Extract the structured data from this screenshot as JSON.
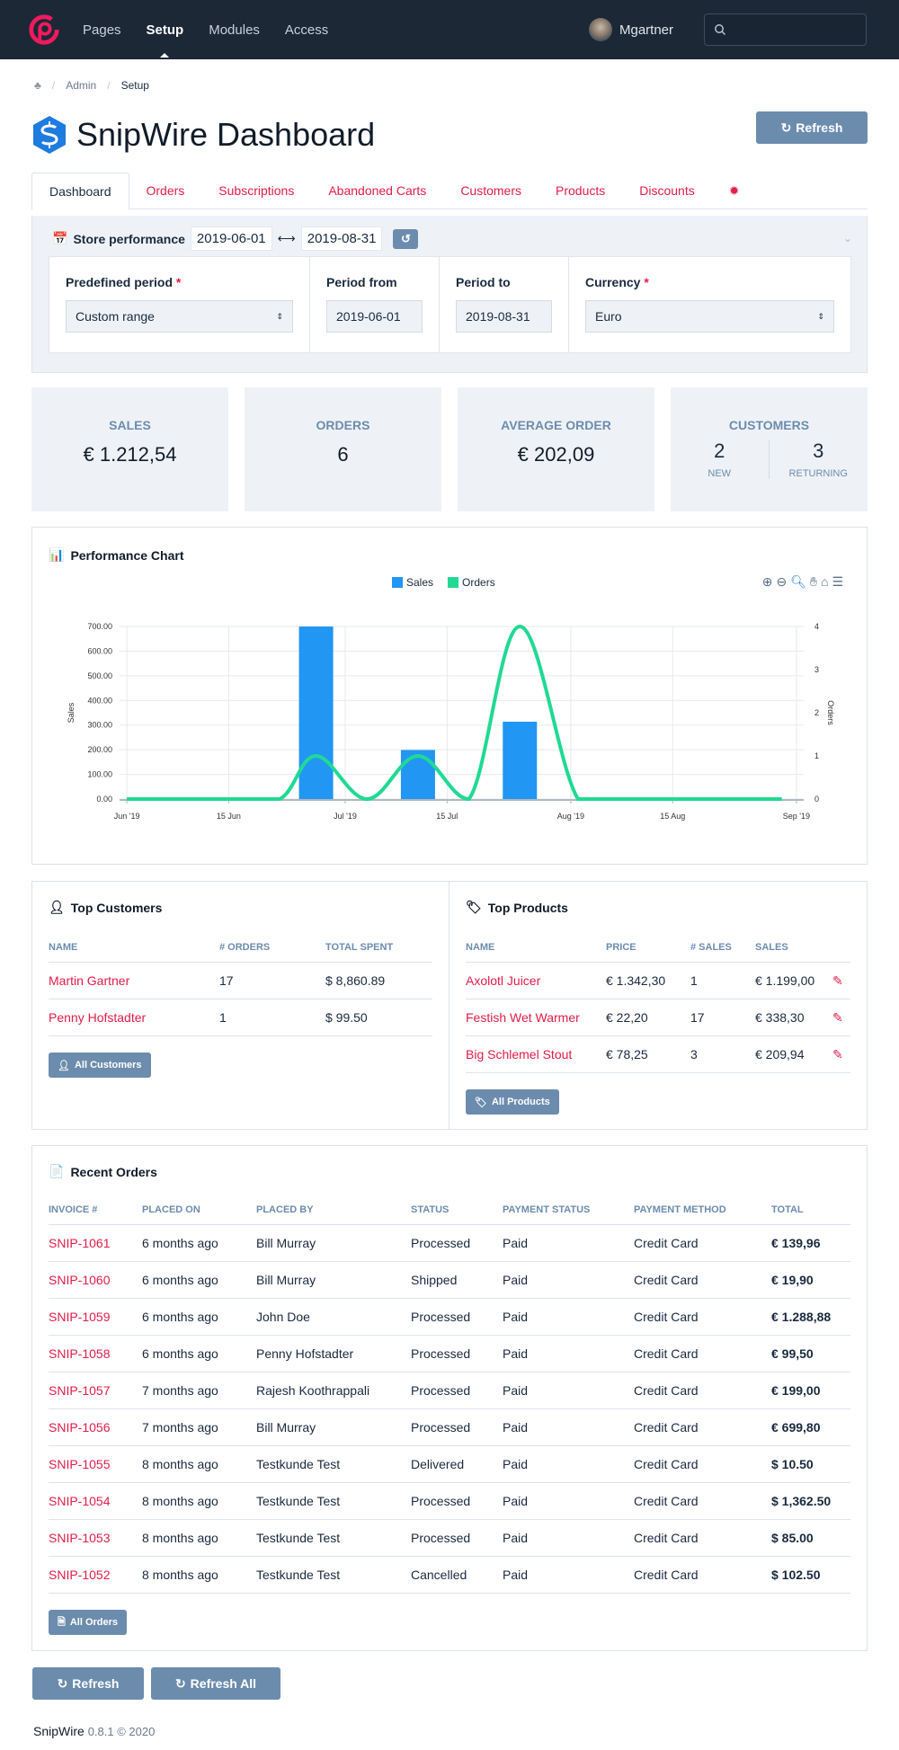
{
  "topbar": {
    "nav": [
      {
        "label": "Pages",
        "active": false
      },
      {
        "label": "Setup",
        "active": true
      },
      {
        "label": "Modules",
        "active": false
      },
      {
        "label": "Access",
        "active": false
      }
    ],
    "user_name": "Mgartner",
    "search_placeholder": ""
  },
  "breadcrumb": {
    "items": [
      "Admin",
      "Setup"
    ]
  },
  "page": {
    "title": "SnipWire Dashboard",
    "refresh_label": "Refresh"
  },
  "tabs": [
    {
      "label": "Dashboard",
      "active": true
    },
    {
      "label": "Orders"
    },
    {
      "label": "Subscriptions"
    },
    {
      "label": "Abandoned Carts"
    },
    {
      "label": "Customers"
    },
    {
      "label": "Products"
    },
    {
      "label": "Discounts"
    }
  ],
  "store_performance": {
    "label": "Store performance",
    "date_from": "2019-06-01",
    "date_to": "2019-08-31",
    "arrow": "⟷",
    "form": {
      "predefined_label": "Predefined period",
      "predefined_value": "Custom range",
      "from_label": "Period from",
      "from_value": "2019-06-01",
      "to_label": "Period to",
      "to_value": "2019-08-31",
      "currency_label": "Currency",
      "currency_value": "Euro",
      "required_mark": "*"
    }
  },
  "stats": {
    "sales_label": "SALES",
    "sales_value": "€ 1.212,54",
    "orders_label": "ORDERS",
    "orders_value": "6",
    "avg_label": "AVERAGE ORDER",
    "avg_value": "€ 202,09",
    "customers_label": "CUSTOMERS",
    "new_value": "2",
    "new_label": "NEW",
    "returning_value": "3",
    "returning_label": "RETURNING"
  },
  "chart_panel": {
    "title": "Performance Chart"
  },
  "chart_data": {
    "type": "bar",
    "title": "Performance Chart",
    "x": [
      "2019-06-01",
      "2019-06-08",
      "2019-06-15",
      "2019-06-22",
      "2019-06-27",
      "2019-07-04",
      "2019-07-11",
      "2019-07-18",
      "2019-07-25",
      "2019-08-02",
      "2019-08-09",
      "2019-08-16",
      "2019-08-23",
      "2019-08-30"
    ],
    "series": [
      {
        "name": "Sales",
        "type": "bar",
        "axis": "left",
        "color": "#2196f3",
        "values": [
          0,
          0,
          0,
          0,
          699.8,
          0,
          199.0,
          0,
          313.74,
          0,
          0,
          0,
          0,
          0
        ]
      },
      {
        "name": "Orders",
        "type": "line",
        "axis": "right",
        "color": "#21d994",
        "values": [
          0,
          0,
          0,
          0,
          1,
          0,
          1,
          0,
          4,
          0,
          0,
          0,
          0,
          0
        ]
      }
    ],
    "xticks": [
      "Jun '19",
      "15 Jun",
      "Jul '19",
      "15 Jul",
      "Aug '19",
      "15 Aug",
      "Sep '19"
    ],
    "xtick_dates": [
      "2019-06-01",
      "2019-06-15",
      "2019-07-01",
      "2019-07-15",
      "2019-08-01",
      "2019-08-15",
      "2019-09-01"
    ],
    "ylabel": "Sales",
    "y2label": "Orders",
    "ylim": [
      0,
      700
    ],
    "yticks": [
      "0.00",
      "100.00",
      "200.00",
      "300.00",
      "400.00",
      "500.00",
      "600.00",
      "700.00"
    ],
    "y2lim": [
      0,
      4
    ],
    "y2ticks": [
      "0",
      "1",
      "2",
      "3",
      "4"
    ],
    "legend": "top-center",
    "grid": true
  },
  "top_customers": {
    "title": "Top Customers",
    "headers": [
      "NAME",
      "# ORDERS",
      "TOTAL SPENT"
    ],
    "rows": [
      [
        "Martin Gartner",
        "17",
        "$ 8,860.89"
      ],
      [
        "Penny Hofstadter",
        "1",
        "$ 99.50"
      ]
    ],
    "button": "All Customers"
  },
  "top_products": {
    "title": "Top Products",
    "headers": [
      "NAME",
      "PRICE",
      "# SALES",
      "SALES"
    ],
    "rows": [
      [
        "Axolotl Juicer",
        "€ 1.342,30",
        "1",
        "€ 1.199,00"
      ],
      [
        "Festish Wet Warmer",
        "€ 22,20",
        "17",
        "€ 338,30"
      ],
      [
        "Big Schlemel Stout",
        "€ 78,25",
        "3",
        "€ 209,94"
      ]
    ],
    "button": "All Products"
  },
  "recent_orders": {
    "title": "Recent Orders",
    "headers": [
      "INVOICE #",
      "PLACED ON",
      "PLACED BY",
      "STATUS",
      "PAYMENT STATUS",
      "PAYMENT METHOD",
      "TOTAL"
    ],
    "rows": [
      [
        "SNIP-1061",
        "6 months ago",
        "Bill Murray",
        "Processed",
        "Paid",
        "Credit Card",
        "€ 139,96"
      ],
      [
        "SNIP-1060",
        "6 months ago",
        "Bill Murray",
        "Shipped",
        "Paid",
        "Credit Card",
        "€ 19,90"
      ],
      [
        "SNIP-1059",
        "6 months ago",
        "John Doe",
        "Processed",
        "Paid",
        "Credit Card",
        "€ 1.288,88"
      ],
      [
        "SNIP-1058",
        "6 months ago",
        "Penny Hofstadter",
        "Processed",
        "Paid",
        "Credit Card",
        "€ 99,50"
      ],
      [
        "SNIP-1057",
        "7 months ago",
        "Rajesh Koothrappali",
        "Processed",
        "Paid",
        "Credit Card",
        "€ 199,00"
      ],
      [
        "SNIP-1056",
        "7 months ago",
        "Bill Murray",
        "Processed",
        "Paid",
        "Credit Card",
        "€ 699,80"
      ],
      [
        "SNIP-1055",
        "8 months ago",
        "Testkunde Test",
        "Delivered",
        "Paid",
        "Credit Card",
        "$ 10.50"
      ],
      [
        "SNIP-1054",
        "8 months ago",
        "Testkunde Test",
        "Processed",
        "Paid",
        "Credit Card",
        "$ 1,362.50"
      ],
      [
        "SNIP-1053",
        "8 months ago",
        "Testkunde Test",
        "Processed",
        "Paid",
        "Credit Card",
        "$ 85.00"
      ],
      [
        "SNIP-1052",
        "8 months ago",
        "Testkunde Test",
        "Cancelled",
        "Paid",
        "Credit Card",
        "$ 102.50"
      ]
    ],
    "button": "All Orders"
  },
  "bottom_buttons": {
    "refresh": "Refresh",
    "refresh_all": "Refresh All"
  },
  "footer": {
    "brand": "SnipWire",
    "version": "0.8.1 © 2020"
  },
  "colors": {
    "accent": "#e11d48",
    "button": "#6c8cae",
    "topbar": "#1c2836",
    "sales": "#2196f3",
    "orders": "#21d994"
  }
}
